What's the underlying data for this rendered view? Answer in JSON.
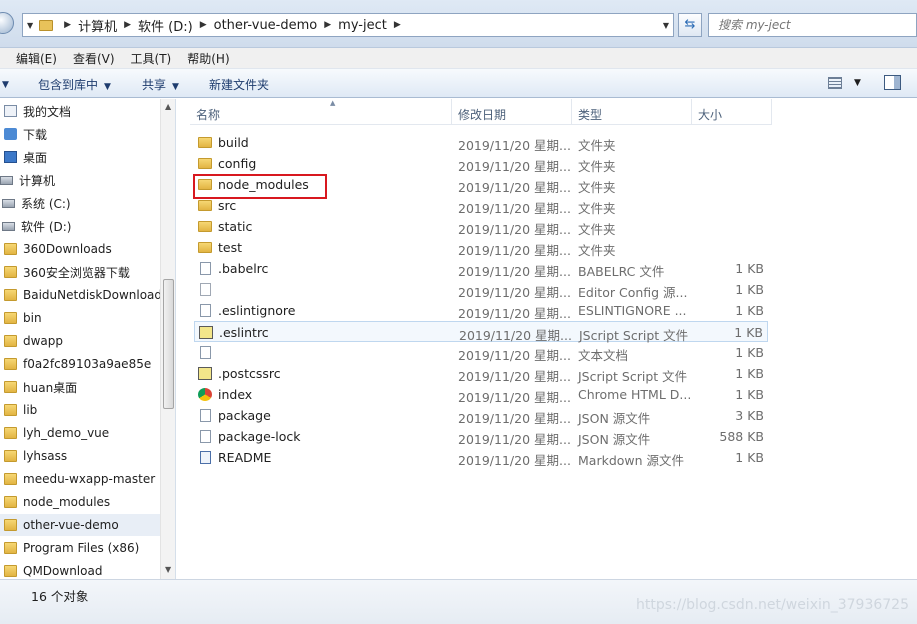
{
  "address_bar": {
    "crumbs": [
      "计算机",
      "软件 (D:)",
      "other-vue-demo",
      "my-ject"
    ],
    "search_placeholder": "搜索 my-ject"
  },
  "menu": {
    "items": [
      "编辑(E)",
      "查看(V)",
      "工具(T)",
      "帮助(H)"
    ]
  },
  "toolbar": {
    "include_library": "包含到库中",
    "share": "共享",
    "new_folder": "新建文件夹"
  },
  "nav_pane": {
    "items": [
      {
        "label": "我的文档",
        "icon": "document-icon"
      },
      {
        "label": "下载",
        "icon": "download-icon"
      },
      {
        "label": "桌面",
        "icon": "desktop-icon"
      },
      {
        "label": "计算机",
        "icon": "computer-icon"
      },
      {
        "label": "系统 (C:)",
        "icon": "drive-icon"
      },
      {
        "label": "软件 (D:)",
        "icon": "drive-icon"
      },
      {
        "label": "360Downloads",
        "icon": "folder-icon"
      },
      {
        "label": "360安全浏览器下载",
        "icon": "folder-icon"
      },
      {
        "label": "BaiduNetdiskDownload",
        "icon": "folder-icon"
      },
      {
        "label": "bin",
        "icon": "folder-icon"
      },
      {
        "label": "dwapp",
        "icon": "folder-icon"
      },
      {
        "label": "f0a2fc89103a9ae85e",
        "icon": "folder-icon"
      },
      {
        "label": "huan桌面",
        "icon": "folder-icon"
      },
      {
        "label": "lib",
        "icon": "folder-icon"
      },
      {
        "label": "lyh_demo_vue",
        "icon": "folder-icon"
      },
      {
        "label": "lyhsass",
        "icon": "folder-icon"
      },
      {
        "label": "meedu-wxapp-master",
        "icon": "folder-icon"
      },
      {
        "label": "node_modules",
        "icon": "folder-icon"
      },
      {
        "label": "other-vue-demo",
        "icon": "folder-icon",
        "selected": true
      },
      {
        "label": "Program Files (x86)",
        "icon": "folder-icon"
      },
      {
        "label": "QMDownload",
        "icon": "folder-icon"
      }
    ]
  },
  "columns": {
    "name": "名称",
    "modified": "修改日期",
    "type": "类型",
    "size": "大小"
  },
  "files": [
    {
      "name": "build",
      "date": "2019/11/20 星期...",
      "type": "文件夹",
      "size": "",
      "icon": "folder-icon"
    },
    {
      "name": "config",
      "date": "2019/11/20 星期...",
      "type": "文件夹",
      "size": "",
      "icon": "folder-icon"
    },
    {
      "name": "node_modules",
      "date": "2019/11/20 星期...",
      "type": "文件夹",
      "size": "",
      "icon": "folder-icon"
    },
    {
      "name": "src",
      "date": "2019/11/20 星期...",
      "type": "文件夹",
      "size": "",
      "icon": "folder-icon"
    },
    {
      "name": "static",
      "date": "2019/11/20 星期...",
      "type": "文件夹",
      "size": "",
      "icon": "folder-icon"
    },
    {
      "name": "test",
      "date": "2019/11/20 星期...",
      "type": "文件夹",
      "size": "",
      "icon": "folder-icon"
    },
    {
      "name": ".babelrc",
      "date": "2019/11/20 星期...",
      "type": "BABELRC 文件",
      "size": "1 KB",
      "icon": "file-icon"
    },
    {
      "name": "",
      "date": "2019/11/20 星期...",
      "type": "Editor Config 源...",
      "size": "1 KB",
      "icon": "config-file-icon"
    },
    {
      "name": ".eslintignore",
      "date": "2019/11/20 星期...",
      "type": "ESLINTIGNORE ...",
      "size": "1 KB",
      "icon": "file-icon"
    },
    {
      "name": ".eslintrc",
      "date": "2019/11/20 星期...",
      "type": "JScript Script 文件",
      "size": "1 KB",
      "icon": "script-icon"
    },
    {
      "name": "",
      "date": "2019/11/20 星期...",
      "type": "文本文档",
      "size": "1 KB",
      "icon": "text-file-icon"
    },
    {
      "name": ".postcssrc",
      "date": "2019/11/20 星期...",
      "type": "JScript Script 文件",
      "size": "1 KB",
      "icon": "script-icon"
    },
    {
      "name": "index",
      "date": "2019/11/20 星期...",
      "type": "Chrome HTML D...",
      "size": "1 KB",
      "icon": "chrome-icon"
    },
    {
      "name": "package",
      "date": "2019/11/20 星期...",
      "type": "JSON 源文件",
      "size": "3 KB",
      "icon": "json-file-icon"
    },
    {
      "name": "package-lock",
      "date": "2019/11/20 星期...",
      "type": "JSON 源文件",
      "size": "588 KB",
      "icon": "json-file-icon"
    },
    {
      "name": "README",
      "date": "2019/11/20 星期...",
      "type": "Markdown 源文件",
      "size": "1 KB",
      "icon": "markdown-icon"
    }
  ],
  "status": {
    "count": "16 个对象"
  },
  "watermark": "https://blog.csdn.net/weixin_37936725",
  "colors": {
    "highlight_box": "#d8181f",
    "folder": "#e2b443"
  }
}
